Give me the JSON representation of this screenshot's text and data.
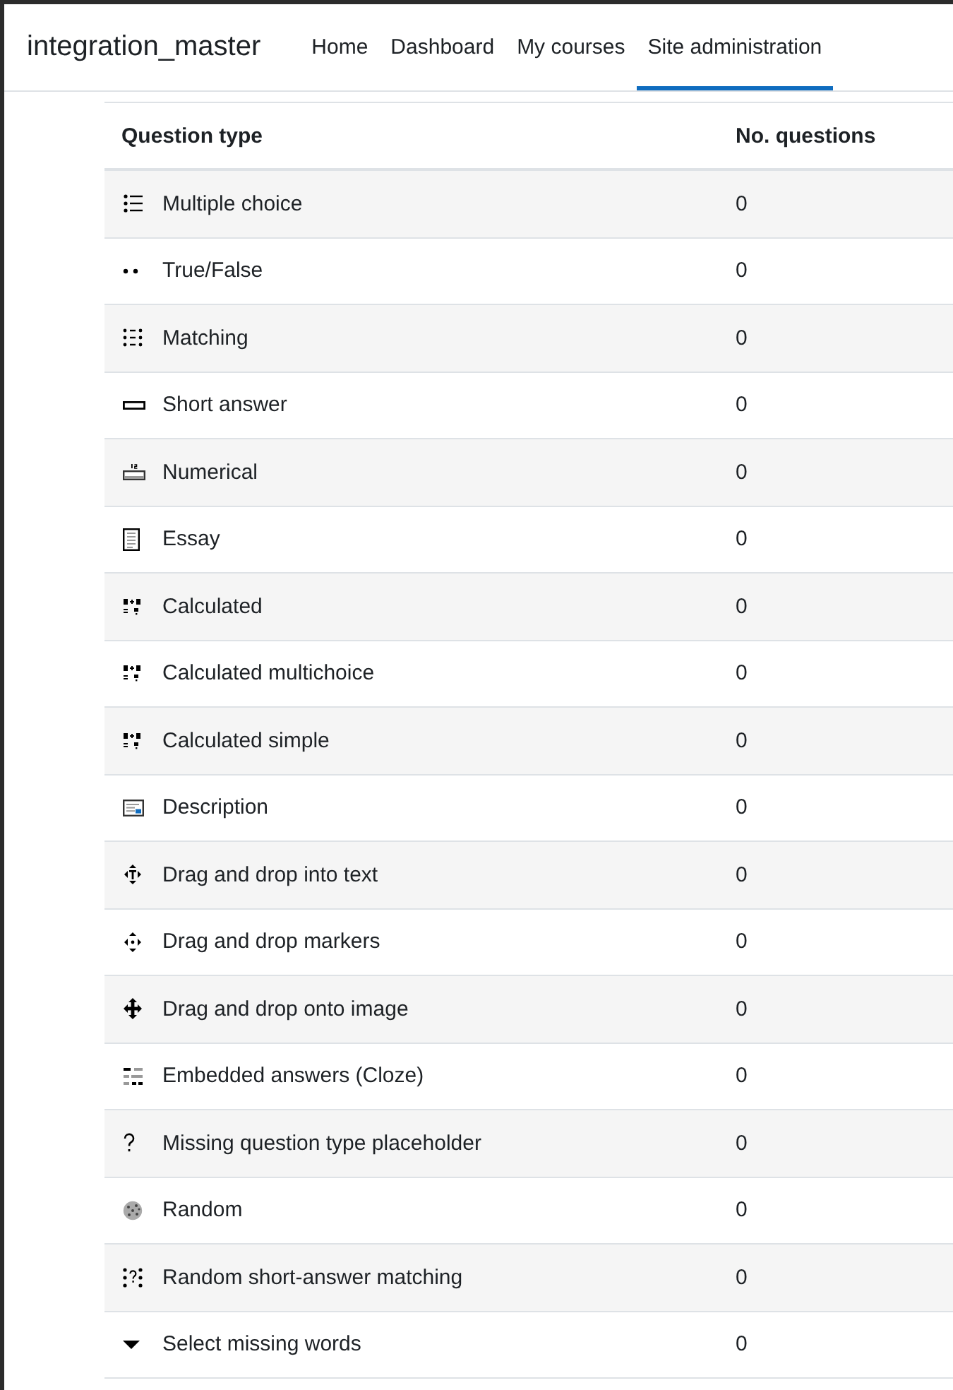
{
  "navbar": {
    "brand": "integration_master",
    "items": [
      {
        "label": "Home",
        "selected": false
      },
      {
        "label": "Dashboard",
        "selected": false
      },
      {
        "label": "My courses",
        "selected": false
      },
      {
        "label": "Site administration",
        "selected": true
      }
    ]
  },
  "table": {
    "columns": [
      "Question type",
      "No. questions"
    ],
    "rows": [
      {
        "kind": "multichoice",
        "name": "Multiple choice",
        "count": "0"
      },
      {
        "kind": "truefalse",
        "name": "True/False",
        "count": "0"
      },
      {
        "kind": "match",
        "name": "Matching",
        "count": "0"
      },
      {
        "kind": "shortanswer",
        "name": "Short answer",
        "count": "0"
      },
      {
        "kind": "numerical",
        "name": "Numerical",
        "count": "0"
      },
      {
        "kind": "essay",
        "name": "Essay",
        "count": "0"
      },
      {
        "kind": "calculated",
        "name": "Calculated",
        "count": "0"
      },
      {
        "kind": "calculatedmulti",
        "name": "Calculated multichoice",
        "count": "0"
      },
      {
        "kind": "calculatedsimple",
        "name": "Calculated simple",
        "count": "0"
      },
      {
        "kind": "description",
        "name": "Description",
        "count": "0"
      },
      {
        "kind": "ddwtos",
        "name": "Drag and drop into text",
        "count": "0"
      },
      {
        "kind": "ddmarker",
        "name": "Drag and drop markers",
        "count": "0"
      },
      {
        "kind": "ddimageortext",
        "name": "Drag and drop onto image",
        "count": "0"
      },
      {
        "kind": "multianswer",
        "name": "Embedded answers (Cloze)",
        "count": "0"
      },
      {
        "kind": "missingtype",
        "name": "Missing question type placeholder",
        "count": "0"
      },
      {
        "kind": "random",
        "name": "Random",
        "count": "0"
      },
      {
        "kind": "randomsamatch",
        "name": "Random short-answer matching",
        "count": "0"
      },
      {
        "kind": "gapselect",
        "name": "Select missing words",
        "count": "0"
      }
    ]
  }
}
